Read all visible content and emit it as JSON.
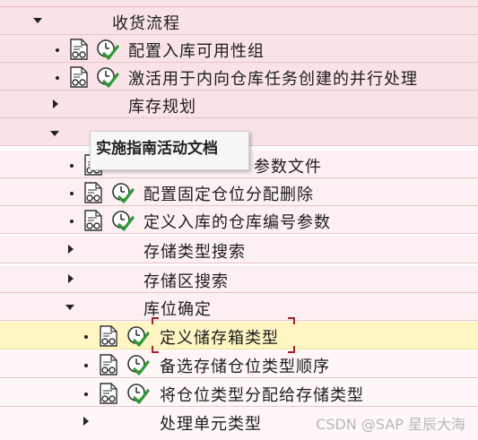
{
  "tree": {
    "items": [
      {
        "label": "收货流程",
        "expanded": true
      },
      {
        "label": "配置入库可用性组"
      },
      {
        "label": "激活用于内向仓库任务创建的并行处理"
      },
      {
        "label": "库存规划",
        "expanded": false
      },
      {
        "label": "",
        "expanded": true
      },
      {
        "label": "参数文件"
      },
      {
        "label": "配置固定仓位分配删除"
      },
      {
        "label": "定义入库的仓库编号参数"
      },
      {
        "label": "存储类型搜索",
        "expanded": false
      },
      {
        "label": "存储区搜索",
        "expanded": false
      },
      {
        "label": "库位确定",
        "expanded": true
      },
      {
        "label": "定义储存箱类型",
        "selected": true
      },
      {
        "label": "备选存储仓位类型顺序"
      },
      {
        "label": "将仓位类型分配给存储类型"
      },
      {
        "label": "处理单元类型",
        "expanded": false
      }
    ]
  },
  "tooltip": {
    "text": "实施指南活动文档"
  },
  "watermark": {
    "text": "CSDN @SAP 星辰大海"
  },
  "colors": {
    "selection_border": "#a4212b",
    "check_green": "#2e9a34",
    "row_pink": "#f9e3e7",
    "row_selected": "#fff6c4"
  }
}
